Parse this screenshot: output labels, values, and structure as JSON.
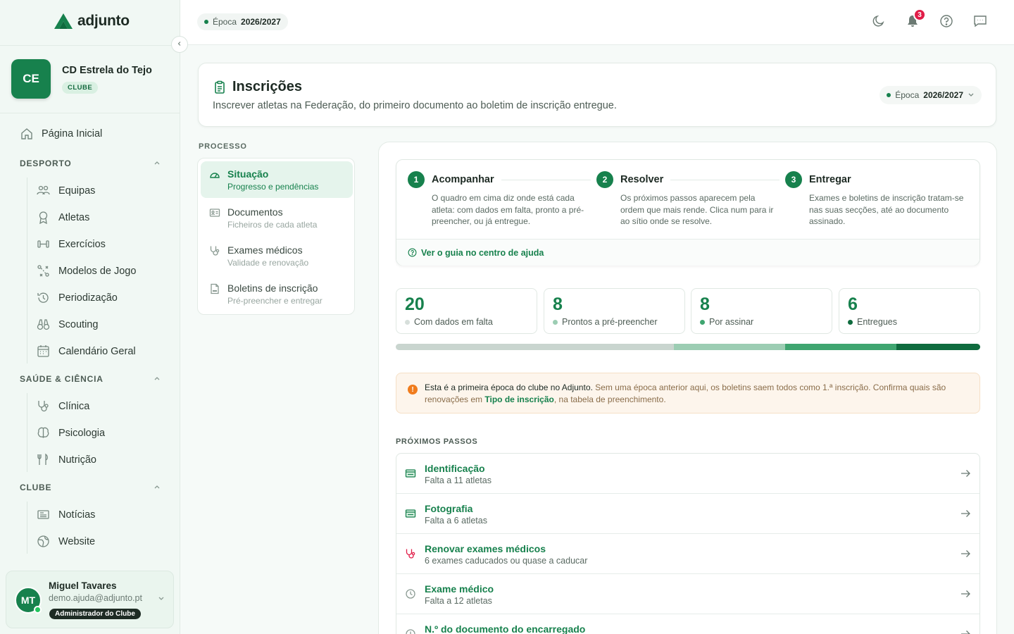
{
  "brand": {
    "name": "adjunto"
  },
  "club": {
    "initials": "CE",
    "name": "CD Estrela do Tejo",
    "badge": "CLUBE"
  },
  "nav": {
    "home": "Página Inicial",
    "sections": [
      {
        "title": "DESPORTO",
        "items": [
          "Equipas",
          "Atletas",
          "Exercícios",
          "Modelos de Jogo",
          "Periodização",
          "Scouting",
          "Calendário Geral"
        ]
      },
      {
        "title": "SAÚDE & CIÊNCIA",
        "items": [
          "Clínica",
          "Psicologia",
          "Nutrição"
        ]
      },
      {
        "title": "CLUBE",
        "items": [
          "Notícias",
          "Website"
        ]
      }
    ]
  },
  "user": {
    "initials": "MT",
    "name": "Miguel Tavares",
    "email": "demo.ajuda@adjunto.pt",
    "role": "Administrador do Clube"
  },
  "topbar": {
    "season_prefix": "Época",
    "season_value": "2026/2027",
    "notif_count": "3"
  },
  "page": {
    "title": "Inscrições",
    "subtitle": "Inscrever atletas na Federação, do primeiro documento ao boletim de inscrição entregue.",
    "season_prefix": "Época",
    "season_value": "2026/2027"
  },
  "process": {
    "label": "PROCESSO",
    "items": [
      {
        "title": "Situação",
        "desc": "Progresso e pendências"
      },
      {
        "title": "Documentos",
        "desc": "Ficheiros de cada atleta"
      },
      {
        "title": "Exames médicos",
        "desc": "Validade e renovação"
      },
      {
        "title": "Boletins de inscrição",
        "desc": "Pré-preencher e entregar"
      }
    ]
  },
  "steps": [
    {
      "num": "1",
      "title": "Acompanhar",
      "desc": "O quadro em cima diz onde está cada atleta: com dados em falta, pronto a pré-preencher, ou já entregue."
    },
    {
      "num": "2",
      "title": "Resolver",
      "desc": "Os próximos passos aparecem pela ordem que mais rende. Clica num para ir ao sítio onde se resolve."
    },
    {
      "num": "3",
      "title": "Entregar",
      "desc": "Exames e boletins de inscrição tratam-se nas suas secções, até ao documento assinado."
    }
  ],
  "guide_link": "Ver o guia no centro de ajuda",
  "stats": [
    {
      "value": "20",
      "label": "Com dados em falta",
      "color": "#d7dfdb"
    },
    {
      "value": "8",
      "label": "Prontos a pré-preencher",
      "color": "#9ccdb3"
    },
    {
      "value": "8",
      "label": "Por assinar",
      "color": "#3fa570"
    },
    {
      "value": "6",
      "label": "Entregues",
      "color": "#0f6b3e"
    }
  ],
  "progress_segments": [
    {
      "value": 20,
      "color": "#c9d5cf"
    },
    {
      "value": 8,
      "color": "#9ccdb3"
    },
    {
      "value": 8,
      "color": "#3fa570"
    },
    {
      "value": 6,
      "color": "#0f6b3e"
    }
  ],
  "alert": {
    "strong": "Esta é a primeira época do clube no Adjunto.",
    "text1": " Sem uma época anterior aqui, os boletins saem todos como 1.ª inscrição. Confirma quais são renovações em ",
    "link": "Tipo de inscrição",
    "text2": ", na tabela de preenchimento."
  },
  "next_steps": {
    "label": "PRÓXIMOS PASSOS",
    "items": [
      {
        "title": "Identificação",
        "sub": "Falta a 11 atletas",
        "icon": "id-card-icon"
      },
      {
        "title": "Fotografia",
        "sub": "Falta a 6 atletas",
        "icon": "id-card-icon"
      },
      {
        "title": "Renovar exames médicos",
        "sub": "6 exames caducados ou quase a caducar",
        "icon": "stethoscope-icon"
      },
      {
        "title": "Exame médico",
        "sub": "Falta a 12 atletas",
        "icon": "clock-icon"
      },
      {
        "title": "N.º do documento do encarregado",
        "sub": "",
        "icon": "clock-icon"
      }
    ]
  },
  "colors": {
    "primary": "#17814d",
    "warning": "#f07c1d",
    "danger": "#e11d48"
  }
}
